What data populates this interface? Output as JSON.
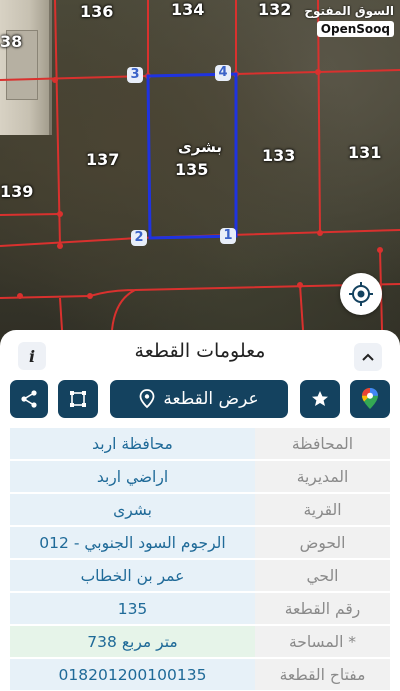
{
  "map": {
    "watermark": {
      "arabic": "السوق المفتوح",
      "english": "OpenSooq"
    },
    "parcel_numbers": [
      {
        "id": "p136",
        "label": "136"
      },
      {
        "id": "p134",
        "label": "134"
      },
      {
        "id": "p132",
        "label": "132"
      },
      {
        "id": "p38",
        "label": "38"
      },
      {
        "id": "p137",
        "label": "137"
      },
      {
        "id": "p133",
        "label": "133"
      },
      {
        "id": "p131",
        "label": "131"
      },
      {
        "id": "p139",
        "label": "139"
      }
    ],
    "selected_parcel": {
      "name": "بشرى",
      "number": "135",
      "outline_color": "#1f33e0"
    },
    "vertices": [
      "1",
      "2",
      "3",
      "4"
    ],
    "boundary_color": "#d9312e"
  },
  "panel": {
    "title": "معلومات القطعة",
    "info_icon": "i",
    "actions": {
      "view_parcel_label": "عرض القطعة",
      "share_icon": "share-icon",
      "frame_icon": "crop-frame-icon",
      "star_icon": "star-icon",
      "google_maps_icon": "google-maps-icon"
    },
    "rows": [
      {
        "label": "المحافظة",
        "value": "محافظة اربد"
      },
      {
        "label": "المديرية",
        "value": "اراضي اربد"
      },
      {
        "label": "القرية",
        "value": "بشرى"
      },
      {
        "label": "الحوض",
        "value": "الرجوم السود الجنوبي - 012"
      },
      {
        "label": "الحي",
        "value": "عمر بن الخطاب"
      },
      {
        "label": "رقم القطعة",
        "value": "135"
      },
      {
        "label": "المساحة *",
        "value": "738  متر مربع"
      },
      {
        "label": "مفتاح القطعة",
        "value": "018201200100135"
      }
    ]
  }
}
